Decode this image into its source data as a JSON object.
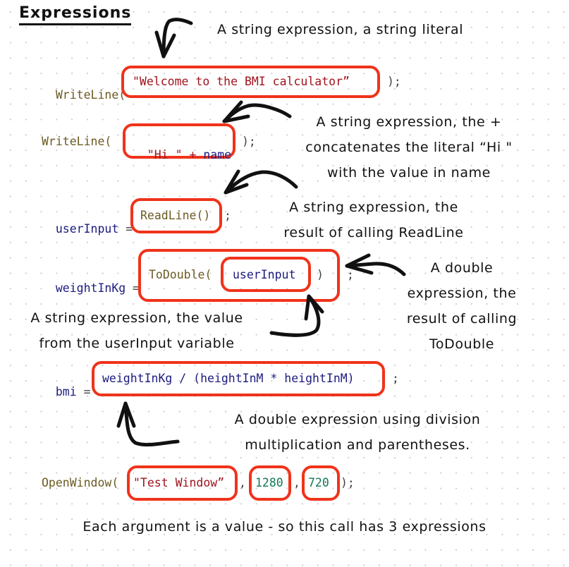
{
  "title": "Expressions",
  "colors": {
    "highlight_box": "#f0331a",
    "function": "#6b5a22",
    "variable": "#1b1b80",
    "string": "#a0141e",
    "number": "#0f7a5a"
  },
  "code_lines": [
    {
      "id": "writeline-welcome",
      "prefix": "WriteLine(",
      "highlighted": "\"Welcome to the BMI calculator”",
      "suffix": ");"
    },
    {
      "id": "writeline-hi",
      "prefix": "WriteLine(",
      "highlighted_string": "\"Hi \"",
      "highlighted_op": "+",
      "highlighted_var": "name",
      "suffix": ");"
    },
    {
      "id": "readline-assign",
      "target": "userInput",
      "equals": "=",
      "highlighted": "ReadLine()",
      "suffix": ";"
    },
    {
      "id": "todouble-assign",
      "target": "weightInKg",
      "equals": "=",
      "highlighted_fn": "ToDouble(",
      "inner_highlighted": "userInput",
      "close_paren": ")",
      "suffix": ";"
    },
    {
      "id": "bmi-assign",
      "target": "bmi",
      "equals": "=",
      "highlighted": "weightInKg / (heightInM * heightInM)",
      "suffix": ";"
    },
    {
      "id": "openwindow-call",
      "prefix": "OpenWindow(",
      "arg1": "\"Test Window”",
      "comma": ",",
      "arg2": "1280",
      "arg3": "720",
      "suffix": ");"
    }
  ],
  "annotations": {
    "string_literal": [
      "A string expression, a string literal"
    ],
    "concatenation": [
      "A string expression, the +",
      "concatenates the literal  “Hi \"",
      "with the value in name"
    ],
    "readline": [
      "A string expression, the",
      "result of calling ReadLine"
    ],
    "todouble": [
      "A double",
      "expression, the",
      "result of calling",
      "ToDouble"
    ],
    "userinput_var": [
      "A string expression, the value",
      "from the userInput variable"
    ],
    "bmi_division": [
      "A double expression using division",
      "multiplication and parentheses."
    ],
    "openwindow_args": [
      "Each argument is a value - so this call has 3 expressions"
    ]
  }
}
